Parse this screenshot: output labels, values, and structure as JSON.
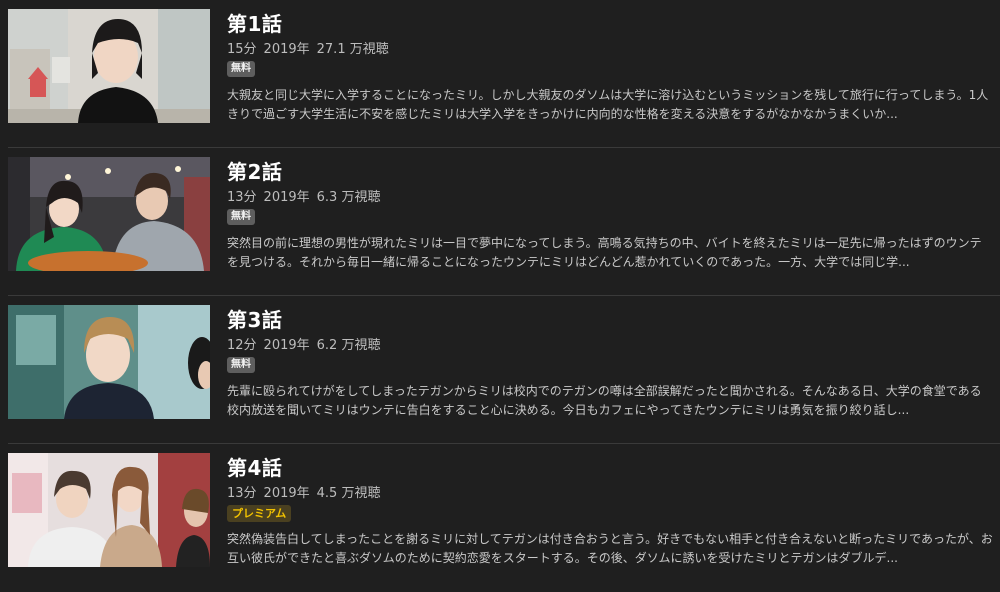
{
  "episodes": [
    {
      "title": "第1話",
      "duration": "15分",
      "year": "2019年",
      "views": "27.1 万視聴",
      "badge": "無料",
      "badge_type": "free",
      "description": "大親友と同じ大学に入学することになったミリ。しかし大親友のダソムは大学に溶け込むというミッションを残して旅行に行ってしまう。1人きりで過ごす大学生活に不安を感じたミリは大学入学をきっかけに内向的な性格を変える決意をするがなかなかうまくいか..."
    },
    {
      "title": "第2話",
      "duration": "13分",
      "year": "2019年",
      "views": "6.3 万視聴",
      "badge": "無料",
      "badge_type": "free",
      "description": "突然目の前に理想の男性が現れたミリは一目で夢中になってしまう。高鳴る気持ちの中、バイトを終えたミリは一足先に帰ったはずのウンテを見つける。それから毎日一緒に帰ることになったウンテにミリはどんどん惹かれていくのであった。一方、大学では同じ学..."
    },
    {
      "title": "第3話",
      "duration": "12分",
      "year": "2019年",
      "views": "6.2 万視聴",
      "badge": "無料",
      "badge_type": "free",
      "description": "先輩に殴られてけがをしてしまったテガンからミリは校内でのテガンの噂は全部誤解だったと聞かされる。そんなある日、大学の食堂である校内放送を聞いてミリはウンテに告白をすること心に決める。今日もカフェにやってきたウンテにミリは勇気を振り絞り話し..."
    },
    {
      "title": "第4話",
      "duration": "13分",
      "year": "2019年",
      "views": "4.5 万視聴",
      "badge": "プレミアム",
      "badge_type": "premium",
      "description": "突然偽装告白してしまったことを謝るミリに対してテガンは付き合おうと言う。好きでもない相手と付き合えないと断ったミリであったが、お互い彼氏ができたと喜ぶダソムのために契約恋愛をスタートする。その後、ダソムに誘いを受けたミリとテガンはダブルデ..."
    }
  ],
  "colors": {
    "background": "#1f1f1f",
    "free_badge": "#5e5e5e",
    "premium_badge_text": "#f2c200"
  }
}
